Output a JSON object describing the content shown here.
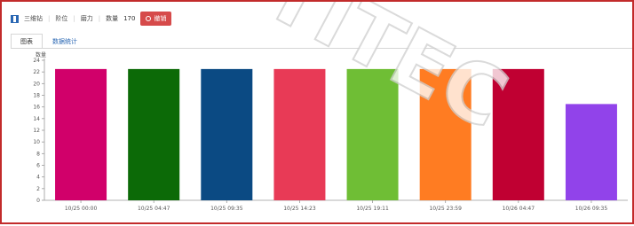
{
  "toolbar": {
    "prefix": "三维钻",
    "label_a": "阶位",
    "label_b": "磨力",
    "label_qty": "数量",
    "qty": "170",
    "cancel": "撤销"
  },
  "tabs": [
    {
      "label": "图表"
    },
    {
      "label": "数据统计"
    }
  ],
  "chart_data": {
    "type": "bar",
    "title": "",
    "xlabel": "",
    "ylabel": "数量",
    "ylim": [
      0,
      24
    ],
    "y_ticks": [
      0,
      2,
      4,
      6,
      8,
      10,
      12,
      14,
      16,
      18,
      20,
      22,
      24
    ],
    "categories": [
      "10/25 00:00",
      "10/25 04:47",
      "10/25 09:35",
      "10/25 14:23",
      "10/25 19:11",
      "10/25 23:59",
      "10/26 04:47",
      "10/26 09:35"
    ],
    "values": [
      22.5,
      22.5,
      22.5,
      22.5,
      22.5,
      22.5,
      22.5,
      16.5
    ],
    "colors": [
      "#d1006a",
      "#0c6a07",
      "#0b4a83",
      "#e83a56",
      "#6fbe35",
      "#ff7c22",
      "#c00032",
      "#9143ea"
    ],
    "grid": false,
    "legend": "none"
  },
  "watermark": {
    "text": "UTITEC"
  }
}
